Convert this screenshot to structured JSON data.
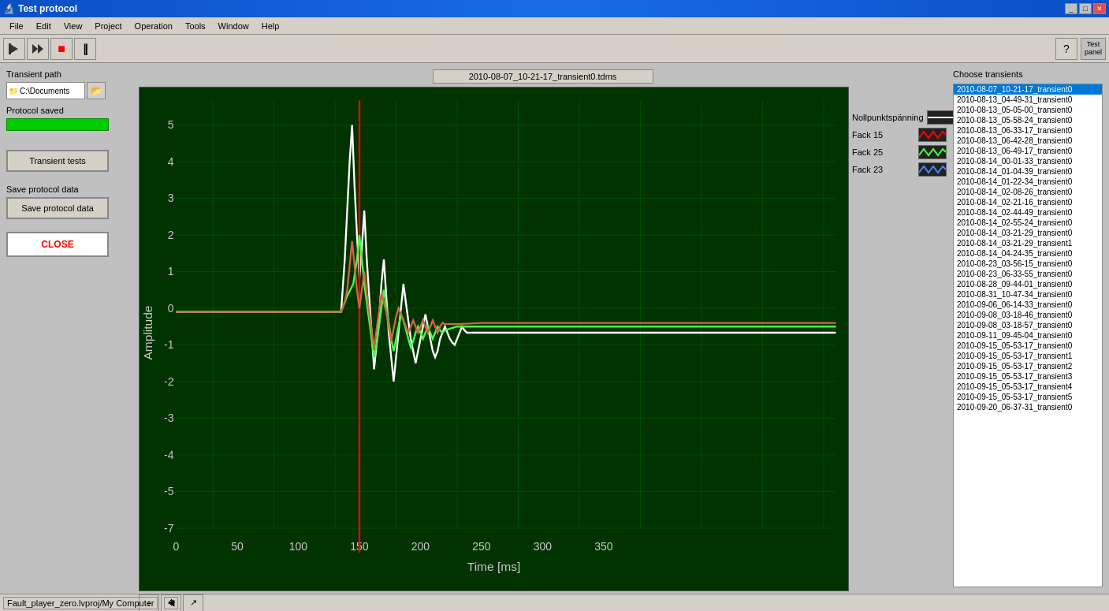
{
  "titleBar": {
    "title": "Test protocol",
    "icon": "🔬"
  },
  "menuBar": {
    "items": [
      "File",
      "Edit",
      "View",
      "Project",
      "Operation",
      "Tools",
      "Window",
      "Help"
    ]
  },
  "chart": {
    "title": "2010-08-07_10-21-17_transient0.tdms",
    "xLabel": "Time [ms]",
    "yLabel": "Amplitude",
    "xMin": 0,
    "xMax": 350,
    "yMin": -7,
    "yMax": 5
  },
  "legend": {
    "items": [
      {
        "label": "Nollpunktspänning",
        "color": "#ffffff",
        "type": "line"
      },
      {
        "label": "Fack 15",
        "color": "#ff4444",
        "type": "zigzag"
      },
      {
        "label": "Fack 25",
        "color": "#44ff44",
        "type": "zigzag"
      },
      {
        "label": "Fack 23",
        "color": "#4444ff",
        "type": "zigzag"
      }
    ]
  },
  "leftPanel": {
    "transientPathLabel": "Transient path",
    "pathValue": "C:\\Documents",
    "protocolSavedLabel": "Protocol saved",
    "saveProtocolLabel": "Save protocol data",
    "closeLabel": "CLOSE",
    "transientTestsLabel": "Transient tests"
  },
  "rightPanel": {
    "title": "Choose transients",
    "items": [
      "2010-08-07_10-21-17_transient0",
      "2010-08-13_04-49-31_transient0",
      "2010-08-13_05-05-00_transient0",
      "2010-08-13_05-58-24_transient0",
      "2010-08-13_06-33-17_transient0",
      "2010-08-13_06-42-28_transient0",
      "2010-08-13_06-49-17_transient0",
      "2010-08-14_00-01-33_transient0",
      "2010-08-14_01-04-39_transient0",
      "2010-08-14_01-22-34_transient0",
      "2010-08-14_02-08-26_transient0",
      "2010-08-14_02-21-16_transient0",
      "2010-08-14_02-44-49_transient0",
      "2010-08-14_02-55-24_transient0",
      "2010-08-14_03-21-29_transient0",
      "2010-08-14_03-21-29_transient1",
      "2010-08-14_04-24-35_transient0",
      "2010-08-23_03-56-15_transient0",
      "2010-08-23_06-33-55_transient0",
      "2010-08-28_09-44-01_transient0",
      "2010-08-31_10-47-34_transient0",
      "2010-09-06_06-14-33_transient0",
      "2010-09-08_03-18-46_transient0",
      "2010-09-08_03-18-57_transient0",
      "2010-09-11_09-45-04_transient0",
      "2010-09-15_05-53-17_transient0",
      "2010-09-15_05-53-17_transient1",
      "2010-09-15_05-53-17_transient2",
      "2010-09-15_05-53-17_transient3",
      "2010-09-15_05-53-17_transient4",
      "2010-09-15_05-53-17_transient5",
      "2010-09-20_06-37-31_transient0"
    ],
    "selectedIndex": 0
  },
  "statusBar": {
    "projectPath": "Fault_player_zero.lvproj/My Computer"
  }
}
